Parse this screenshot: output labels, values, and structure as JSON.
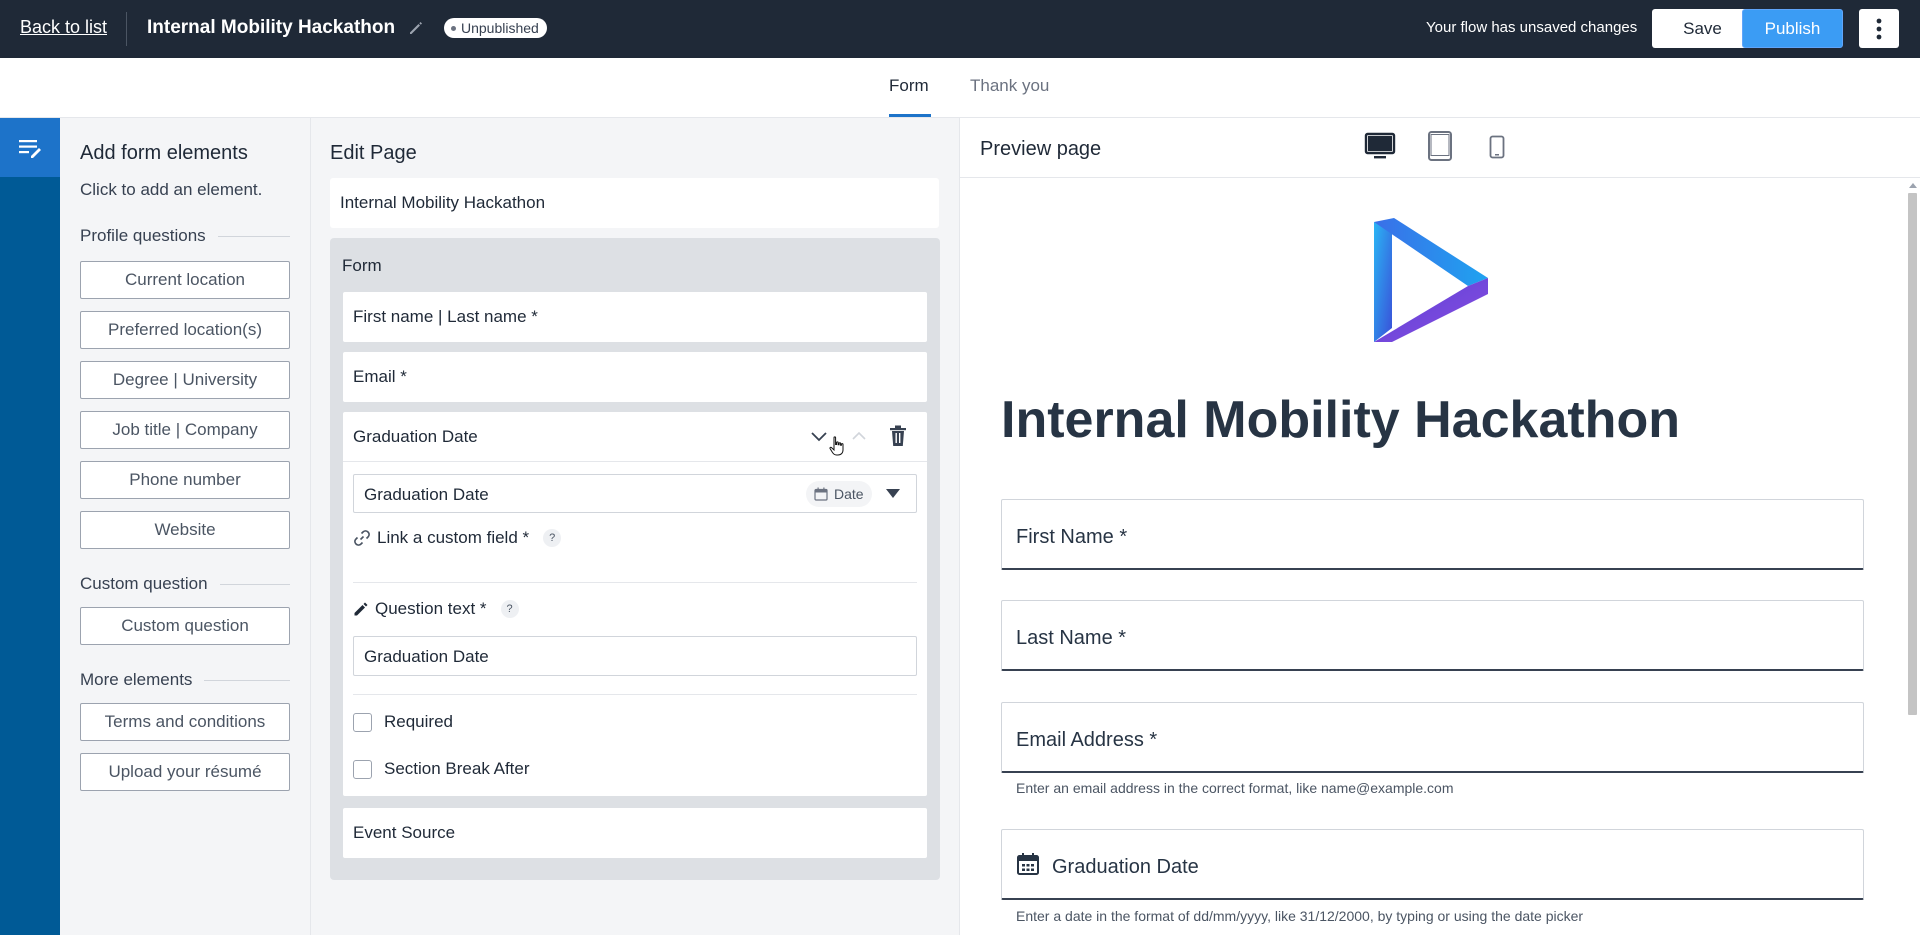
{
  "topbar": {
    "back_label": "Back to list",
    "title": "Internal Mobility Hackathon",
    "status": "Unpublished",
    "unsaved_message": "Your flow has unsaved changes",
    "save_label": "Save",
    "publish_label": "Publish",
    "publish_color": "#3b9cf4"
  },
  "tabs": [
    {
      "label": "Form",
      "active": true
    },
    {
      "label": "Thank you",
      "active": false
    }
  ],
  "add_panel": {
    "title": "Add form elements",
    "subtitle": "Click to add an element.",
    "sections": [
      {
        "heading": "Profile questions",
        "items": [
          "Current location",
          "Preferred location(s)",
          "Degree | University",
          "Job title | Company",
          "Phone number",
          "Website"
        ]
      },
      {
        "heading": "Custom question",
        "items": [
          "Custom question"
        ]
      },
      {
        "heading": "More elements",
        "items": [
          "Terms and conditions",
          "Upload your résumé"
        ]
      }
    ]
  },
  "edit_panel": {
    "title": "Edit Page",
    "page_name": "Internal Mobility Hackathon",
    "form_label": "Form",
    "fields": [
      "First name | Last name *",
      "Email *"
    ],
    "expanded": {
      "title": "Graduation Date",
      "field_value": "Graduation Date",
      "type_chip": "Date",
      "link_label": "Link a custom field *",
      "question_label": "Question text *",
      "question_value": "Graduation Date",
      "help_symbol": "?",
      "required_label": "Required",
      "required_checked": false,
      "section_break_label": "Section Break After",
      "section_break_checked": false
    },
    "after_fields": [
      "Event Source"
    ]
  },
  "preview": {
    "title": "Preview page",
    "devices": [
      "desktop-icon",
      "tablet-icon",
      "mobile-icon"
    ],
    "heading": "Internal Mobility Hackathon",
    "fields": [
      "First Name *",
      "Last Name *",
      "Email Address *",
      "Graduation Date"
    ],
    "email_help": "Enter an email address in the correct format, like name@example.com",
    "date_help": "Enter a date in the format of dd/mm/yyyy, like 31/12/2000, by typing or using the date picker"
  },
  "colors": {
    "topbar_bg": "#1f2937",
    "rail_bg": "#005a96",
    "accent": "#1d73c9"
  }
}
